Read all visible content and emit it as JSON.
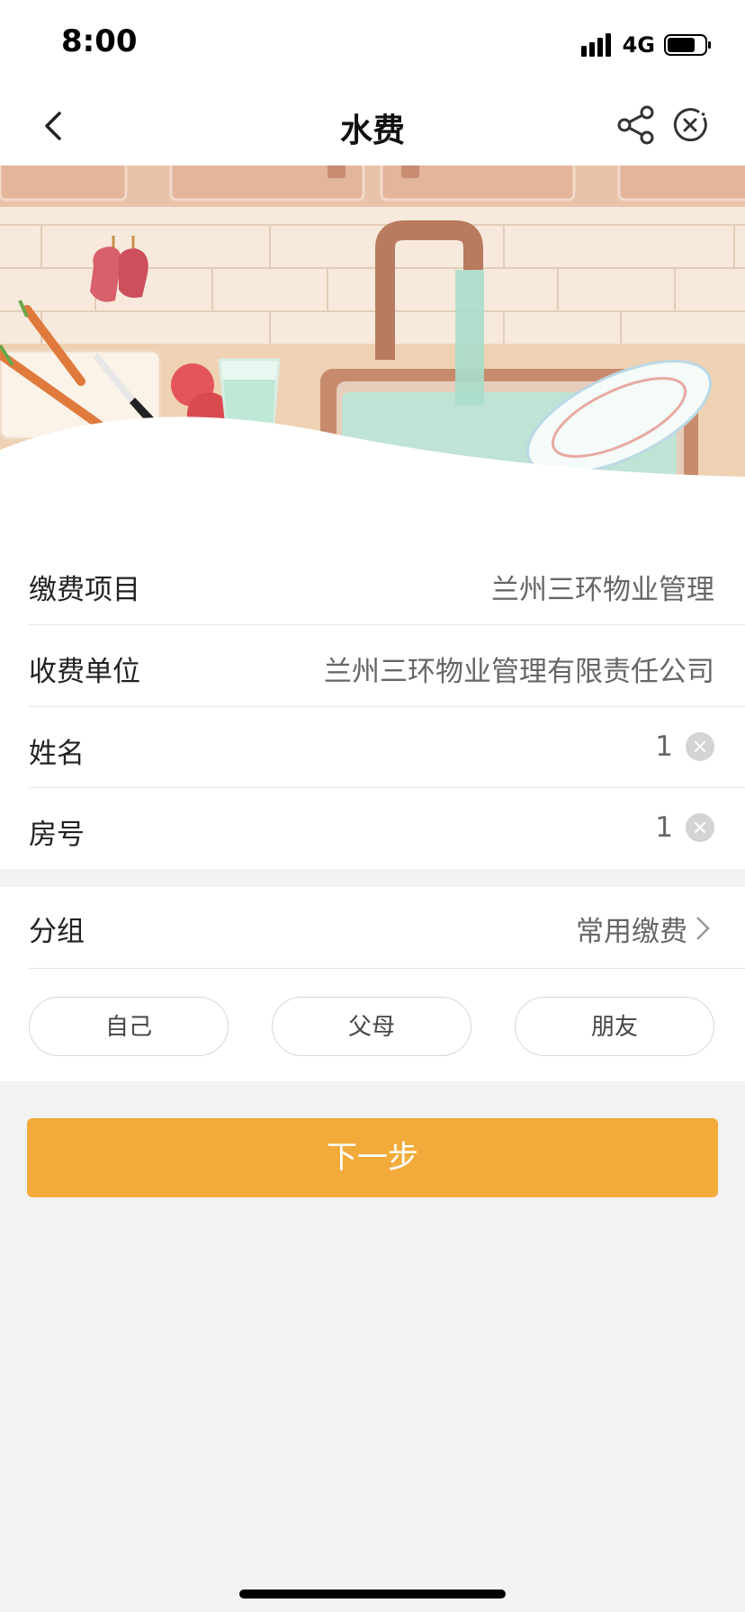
{
  "status_bar": {
    "time": "8:00",
    "network": "4G",
    "battery_level": 0.75
  },
  "nav": {
    "title": "水费",
    "icons": [
      "back-icon",
      "share-icon",
      "close-icon"
    ]
  },
  "banner": {
    "description_icons": [
      "kitchen-sink-illustration"
    ]
  },
  "form": {
    "rows": [
      {
        "label": "缴费项目",
        "value": "兰州三环物业管理"
      },
      {
        "label": "收费单位",
        "value": "兰州三环物业管理有限责任公司"
      },
      {
        "label": "姓名",
        "value": "1"
      },
      {
        "label": "房号",
        "value": "1"
      }
    ]
  },
  "group": {
    "label": "分组",
    "value": "常用缴费",
    "options": [
      "自己",
      "父母",
      "朋友"
    ]
  },
  "next_button": "下一步",
  "colors": {
    "accent": "#f2ab3b",
    "background": "#f2f2f2"
  }
}
